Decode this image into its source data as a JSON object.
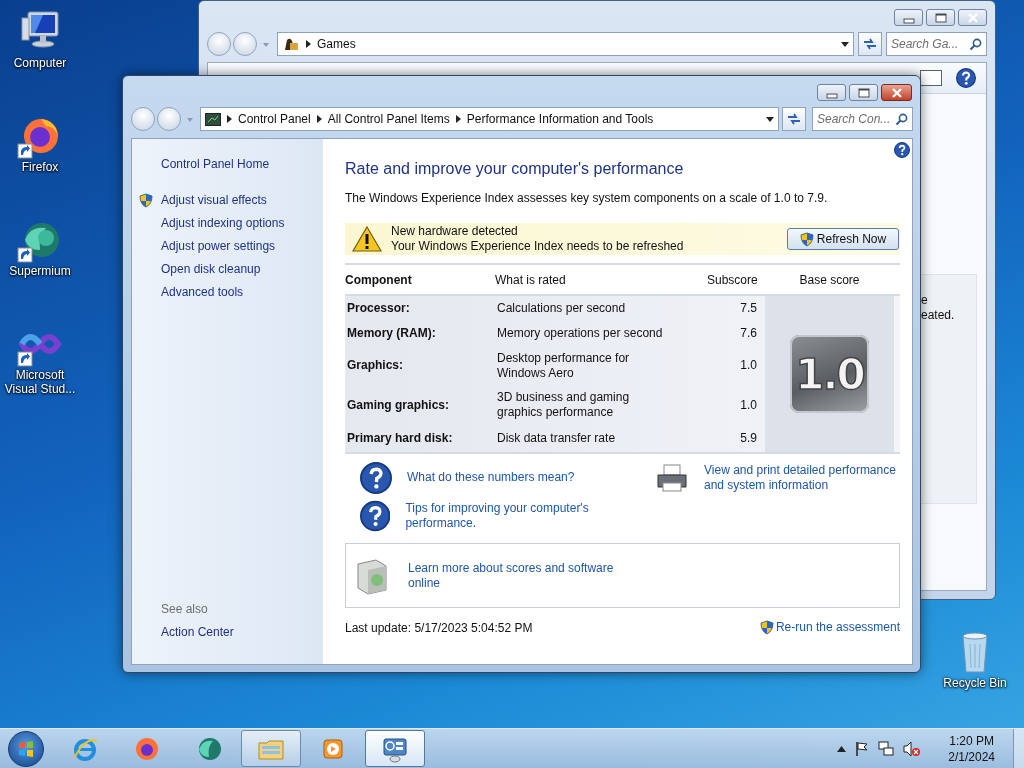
{
  "desktop_icons": [
    {
      "label": "Computer",
      "kind": "computer",
      "shortcut": false
    },
    {
      "label": "Firefox",
      "kind": "firefox",
      "shortcut": true
    },
    {
      "label": "Supermium",
      "kind": "supermium",
      "shortcut": true
    },
    {
      "label": "Microsoft Visual Stud...",
      "kind": "visual-studio",
      "shortcut": true
    },
    {
      "label": "Recycle Bin",
      "kind": "recycle-bin",
      "shortcut": false
    }
  ],
  "background_window": {
    "location": "Games",
    "search": {
      "placeholder": "Search Ga..."
    },
    "text_fragments": [
      "e",
      "eated."
    ]
  },
  "window": {
    "breadcrumb": [
      "Control Panel",
      "All Control Panel Items",
      "Performance Information and Tools"
    ],
    "search": {
      "placeholder": "Search Con..."
    },
    "sidebar": {
      "home": "Control Panel Home",
      "tasks": [
        {
          "label": "Adjust visual effects",
          "shield": true
        },
        {
          "label": "Adjust indexing options",
          "shield": false
        },
        {
          "label": "Adjust power settings",
          "shield": false
        },
        {
          "label": "Open disk cleanup",
          "shield": false
        },
        {
          "label": "Advanced tools",
          "shield": false
        }
      ],
      "see_also_title": "See also",
      "see_also": [
        "Action Center"
      ]
    },
    "title": "Rate and improve your computer's performance",
    "intro": "The Windows Experience Index assesses key system components on a scale of 1.0 to 7.9.",
    "notice": {
      "title": "New hardware detected",
      "message": "Your Windows Experience Index needs to be refreshed",
      "button": "Refresh Now"
    },
    "table": {
      "columns": [
        "Component",
        "What is rated",
        "Subscore",
        "Base score"
      ],
      "rows": [
        {
          "component": "Processor:",
          "rated": "Calculations per second",
          "subscore": "7.5"
        },
        {
          "component": "Memory (RAM):",
          "rated": "Memory operations per second",
          "subscore": "7.6"
        },
        {
          "component": "Graphics:",
          "rated": "Desktop performance for Windows Aero",
          "subscore": "1.0"
        },
        {
          "component": "Gaming graphics:",
          "rated": "3D business and gaming graphics performance",
          "subscore": "1.0"
        },
        {
          "component": "Primary hard disk:",
          "rated": "Disk data transfer rate",
          "subscore": "5.9"
        }
      ],
      "base_score": "1.0"
    },
    "help_links": [
      "What do these numbers mean?",
      "Tips for improving your computer's performance."
    ],
    "print_link": "View and print detailed performance and system information",
    "learn_more": "Learn more about scores and software online",
    "last_update": "Last update: 5/17/2023 5:04:52 PM",
    "rerun": "Re-run the assessment"
  },
  "taskbar": {
    "items": [
      {
        "kind": "internet-explorer",
        "open": false,
        "selected": false
      },
      {
        "kind": "firefox",
        "open": false,
        "selected": false
      },
      {
        "kind": "supermium",
        "open": false,
        "selected": false
      },
      {
        "kind": "file-explorer",
        "open": true,
        "selected": false
      },
      {
        "kind": "media-player",
        "open": false,
        "selected": false
      },
      {
        "kind": "control-panel",
        "open": true,
        "selected": true
      }
    ],
    "time": "1:20 PM",
    "date": "2/1/2024"
  }
}
